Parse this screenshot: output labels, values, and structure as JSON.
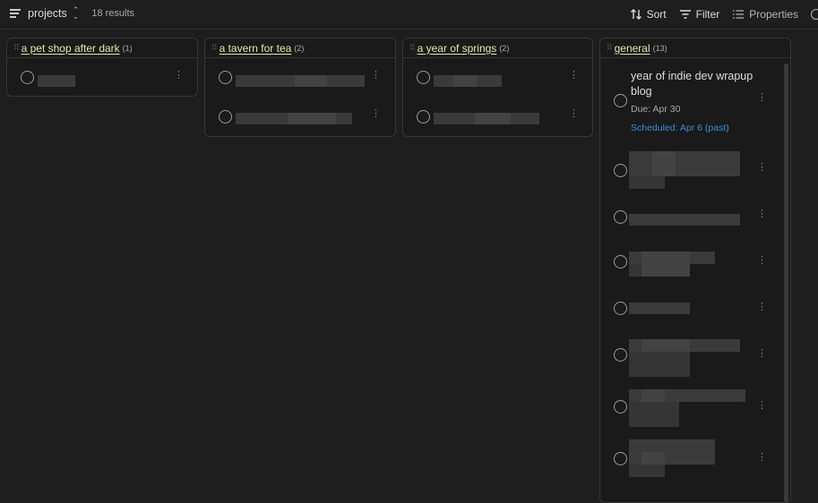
{
  "toolbar": {
    "view_name": "projects",
    "results": "18 results",
    "sort_label": "Sort",
    "filter_label": "Filter",
    "properties_label": "Properties"
  },
  "columns": [
    {
      "title": "a pet shop after dark",
      "count": "(1)"
    },
    {
      "title": "a tavern for tea",
      "count": "(2)"
    },
    {
      "title": "a year of springs",
      "count": "(2)"
    },
    {
      "title": "general",
      "count": "(13)"
    }
  ],
  "general_first_task": {
    "title": "year of indie dev wrapup blog",
    "due": "Due: Apr 30",
    "scheduled": "Scheduled: Apr 6 (past)"
  },
  "colors": {
    "background": "#1e1e1e",
    "column_title": "#e6e9a8",
    "scheduled": "#3f8cdb"
  },
  "icons": [
    "list-view-icon",
    "sort-icon",
    "filter-icon",
    "properties-icon",
    "search-icon",
    "circle-checkbox-icon",
    "more-vertical-icon",
    "drag-handle-icon"
  ]
}
